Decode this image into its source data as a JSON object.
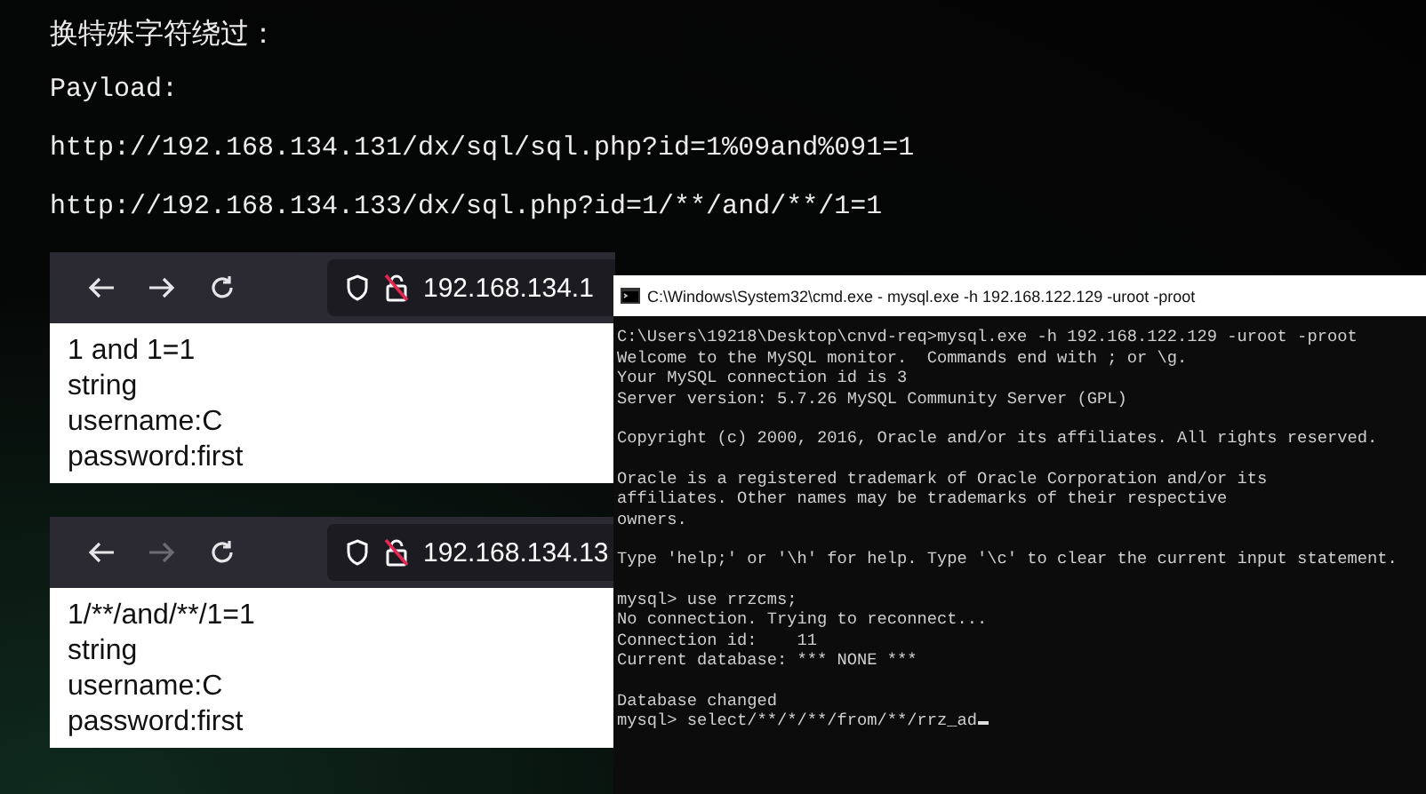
{
  "slide": {
    "heading": "换特殊字符绕过：",
    "label": "Payload:",
    "urls": [
      "http://192.168.134.131/dx/sql/sql.php?id=1%09and%091=1",
      "http://192.168.134.133/dx/sql.php?id=1/**/and/**/1=1"
    ]
  },
  "browsers": [
    {
      "address": "192.168.134.1",
      "forward_disabled": false,
      "lines": [
        "1 and 1=1",
        "string",
        "username:C",
        "password:first"
      ]
    },
    {
      "address": "192.168.134.13",
      "forward_disabled": true,
      "lines": [
        "1/**/and/**/1=1",
        "string",
        "username:C",
        "password:first"
      ]
    }
  ],
  "terminal": {
    "title": "C:\\Windows\\System32\\cmd.exe - mysql.exe  -h 192.168.122.129 -uroot -proot",
    "paragraphs": [
      [
        "C:\\Users\\19218\\Desktop\\cnvd-req>mysql.exe -h 192.168.122.129 -uroot -proot",
        "Welcome to the MySQL monitor.  Commands end with ; or \\g.",
        "Your MySQL connection id is 3",
        "Server version: 5.7.26 MySQL Community Server (GPL)"
      ],
      [
        "Copyright (c) 2000, 2016, Oracle and/or its affiliates. All rights reserved."
      ],
      [
        "Oracle is a registered trademark of Oracle Corporation and/or its",
        "affiliates. Other names may be trademarks of their respective",
        "owners."
      ],
      [
        "Type 'help;' or '\\h' for help. Type '\\c' to clear the current input statement."
      ],
      [
        "mysql> use rrzcms;",
        "No connection. Trying to reconnect...",
        "Connection id:    11",
        "Current database: *** NONE ***"
      ],
      [
        "Database changed",
        "mysql> select/**/*/**/from/**/rrz_ad"
      ]
    ]
  }
}
